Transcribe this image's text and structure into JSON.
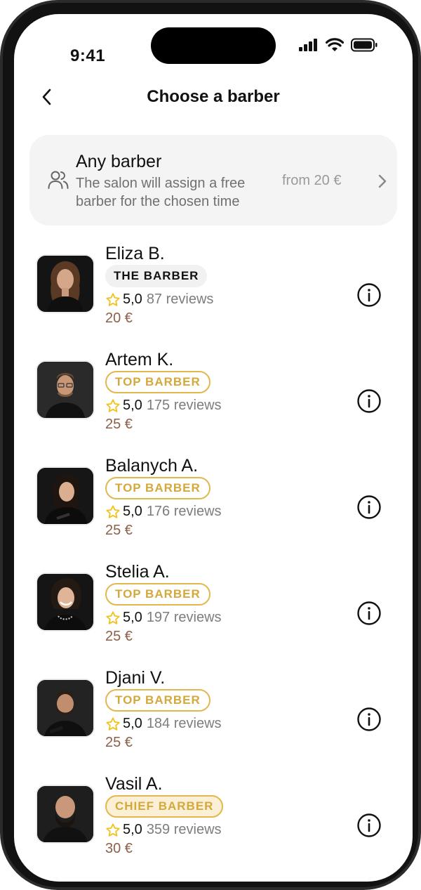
{
  "status_bar": {
    "time": "9:41"
  },
  "header": {
    "title": "Choose a barber"
  },
  "any_barber": {
    "title": "Any barber",
    "description": "The salon will assign a free barber for the chosen time",
    "price": "from 20 €"
  },
  "barbers": [
    {
      "name": "Eliza B.",
      "badge": "THE BARBER",
      "badge_style": "the",
      "rating": "5,0",
      "reviews": "87 reviews",
      "price": "20 €"
    },
    {
      "name": "Artem K.",
      "badge": "TOP BARBER",
      "badge_style": "top",
      "rating": "5,0",
      "reviews": "175 reviews",
      "price": "25 €"
    },
    {
      "name": "Balanych A.",
      "badge": "TOP BARBER",
      "badge_style": "top",
      "rating": "5,0",
      "reviews": "176 reviews",
      "price": "25 €"
    },
    {
      "name": "Stelia A.",
      "badge": "TOP BARBER",
      "badge_style": "top",
      "rating": "5,0",
      "reviews": "197 reviews",
      "price": "25 €"
    },
    {
      "name": "Djani V.",
      "badge": "TOP BARBER",
      "badge_style": "top",
      "rating": "5,0",
      "reviews": "184 reviews",
      "price": "25 €"
    },
    {
      "name": "Vasil A.",
      "badge": "CHIEF BARBER",
      "badge_style": "chief",
      "rating": "5,0",
      "reviews": "359 reviews",
      "price": "30 €"
    }
  ],
  "colors": {
    "accent_gold": "#d4a83a",
    "price_brown": "#8d5f48",
    "card_bg": "#f4f4f4",
    "star": "#f2c21b"
  },
  "icons": {
    "back": "chevron-left-icon",
    "people": "users-icon",
    "chevron": "chevron-right-icon",
    "star": "star-icon",
    "info": "info-circle-icon"
  }
}
